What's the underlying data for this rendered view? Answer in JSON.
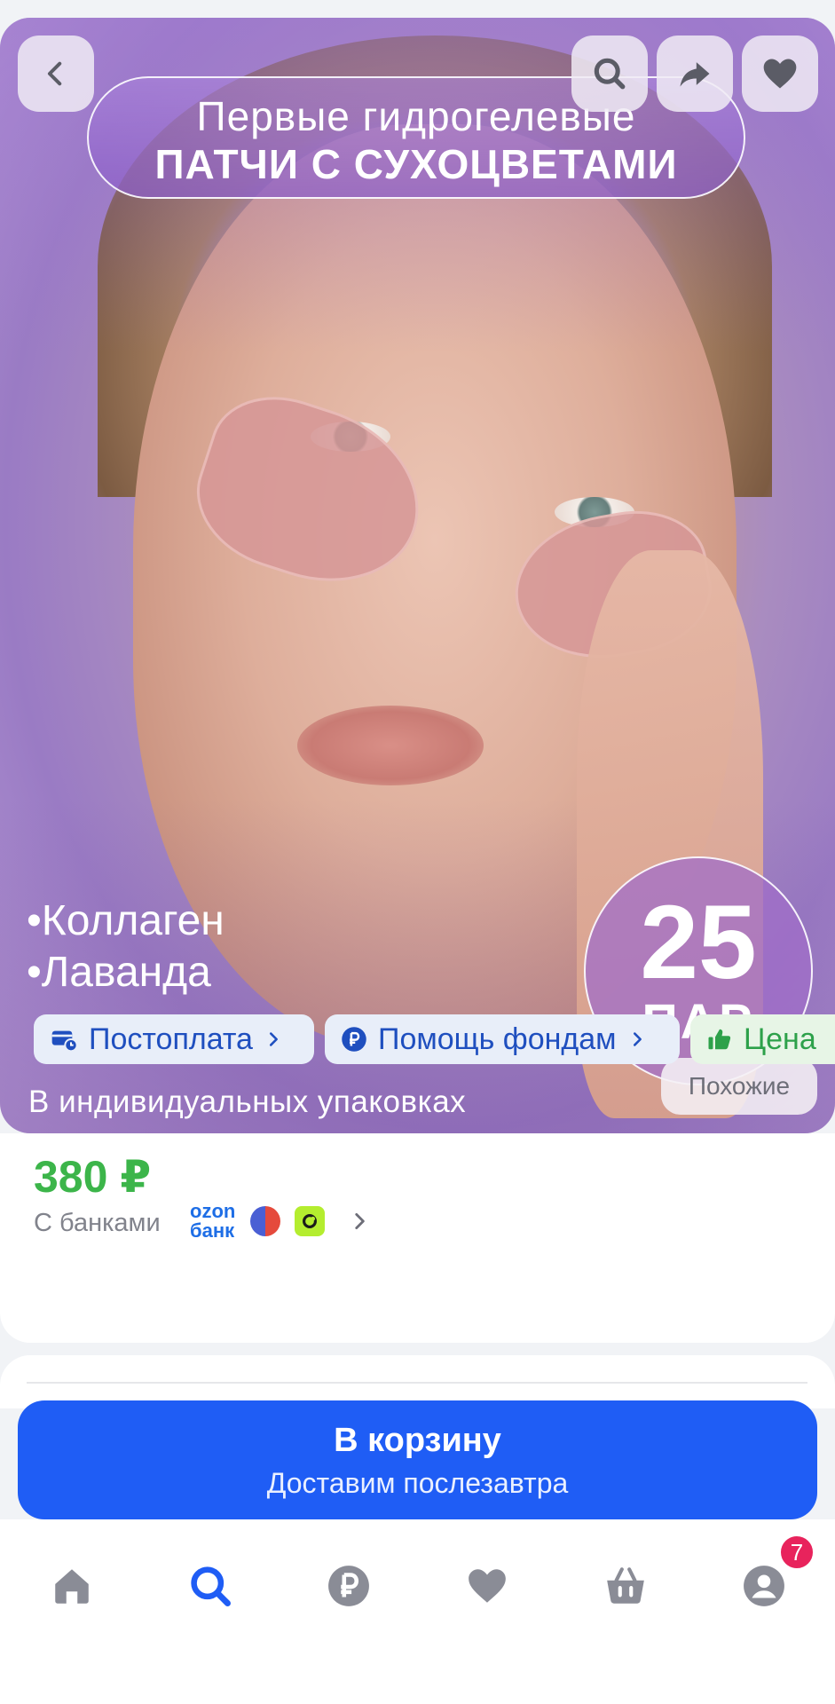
{
  "product_image": {
    "banner_line1": "Первые гидрогелевые",
    "banner_line2": "ПАТЧИ С СУХОЦВЕТАМИ",
    "bullets": [
      "•Коллаген",
      "•Лаванда"
    ],
    "package_note": "В индивидуальных упаковках",
    "count_number": "25",
    "count_unit": "ПАР",
    "similar_label": "Похожие"
  },
  "top_actions": {
    "back": "chevron-left-icon",
    "search": "search-icon",
    "share": "share-icon",
    "favorite": "heart-icon"
  },
  "price": {
    "value": "380 ₽",
    "banks_label": "С банками",
    "ozon_bank_line1": "ozon",
    "ozon_bank_line2": "банк"
  },
  "chips": [
    {
      "label": "Постоплата",
      "icon": "wallet-clock-icon"
    },
    {
      "label": "Помощь фондам",
      "icon": "ruble-coin-icon"
    },
    {
      "label": "Цена",
      "icon": "thumbs-up-icon"
    }
  ],
  "cart": {
    "title": "В корзину",
    "subtitle": "Доставим послезавтра"
  },
  "tabbar": {
    "items": [
      "home-icon",
      "search-icon",
      "ruble-icon",
      "heart-icon",
      "basket-icon",
      "profile-icon"
    ],
    "profile_badge": "7"
  },
  "colors": {
    "accent_blue": "#1f5df5",
    "price_green": "#3cb54a",
    "badge_pink": "#e8235c"
  }
}
